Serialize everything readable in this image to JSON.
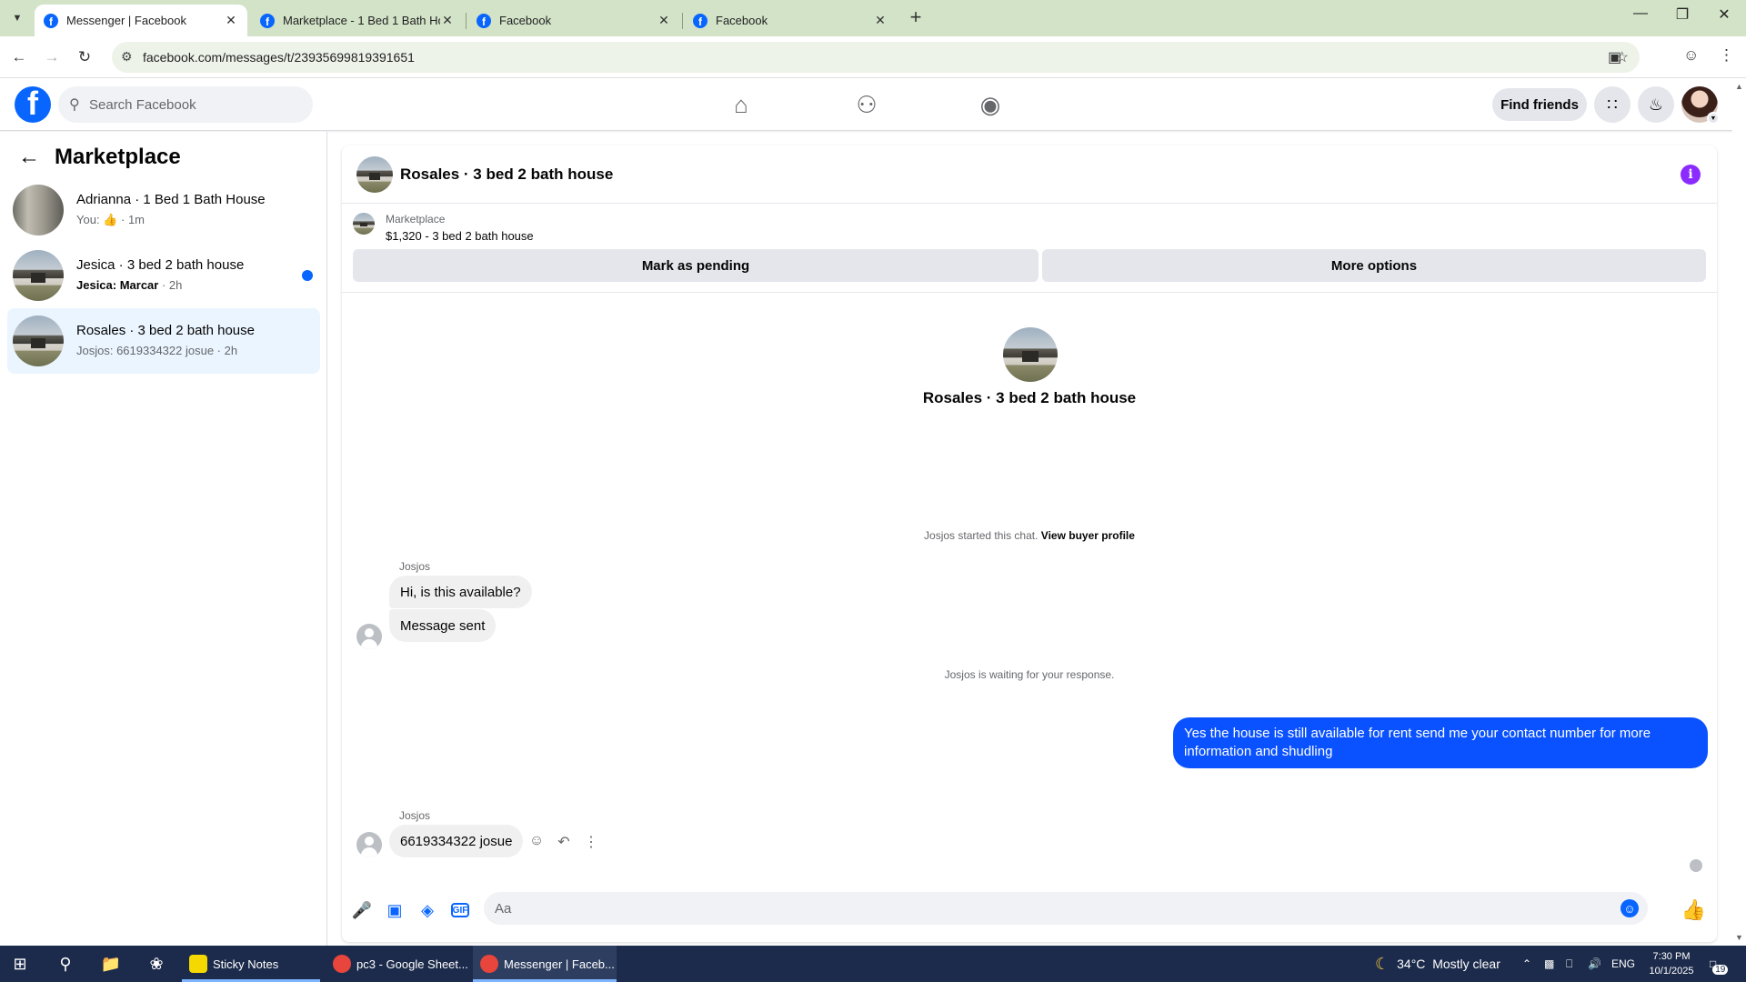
{
  "browser": {
    "tabs": [
      {
        "title": "Messenger | Facebook",
        "active": true
      },
      {
        "title": "Marketplace - 1 Bed 1 Bath Ho",
        "active": false
      },
      {
        "title": "Facebook",
        "active": false
      },
      {
        "title": "Facebook",
        "active": false
      }
    ],
    "url": "facebook.com/messages/t/23935699819391651"
  },
  "fb": {
    "search_placeholder": "Search Facebook",
    "find_friends": "Find friends"
  },
  "sidebar": {
    "title": "Marketplace",
    "conversations": [
      {
        "name": "Adrianna · 1 Bed 1 Bath House",
        "snippet_prefix": "You:",
        "snippet": "· 1m",
        "unread": false
      },
      {
        "name": "Jesica · 3 bed 2 bath house",
        "snippet_prefix": "Jesica: Marcar",
        "snippet": "· 2h",
        "unread": true
      },
      {
        "name": "Rosales · 3 bed 2 bath house",
        "snippet_prefix": "",
        "snippet": "Josjos: 6619334322 josue · 2h",
        "unread": false
      }
    ]
  },
  "chat": {
    "title": "Rosales · 3 bed 2 bath house",
    "listing_label": "Marketplace",
    "listing_price": "$1,320 - 3 bed 2 bath house",
    "mark_pending": "Mark as pending",
    "more_options": "More options",
    "intro_title": "Rosales · 3 bed 2 bath house",
    "started_text": "Josjos started this chat.",
    "view_profile": "View buyer profile",
    "sender_name": "Josjos",
    "msg1": "Hi, is this available?",
    "msg2": "Message sent",
    "waiting_text": "Josjos is waiting for your response.",
    "out_msg": "Yes the house is still available for rent send me your contact number for more information and shudling",
    "msg3": "6619334322 josue",
    "composer_placeholder": "Aa"
  },
  "taskbar": {
    "apps": [
      {
        "label": "Sticky Notes",
        "color": "#f5d800"
      },
      {
        "label": "pc3 - Google Sheet...",
        "color": "#e8453c"
      },
      {
        "label": "Messenger | Faceb...",
        "color": "#e8453c"
      }
    ],
    "weather": "34°C  Mostly clear",
    "lang": "ENG",
    "time": "7:30 PM",
    "date": "10/1/2025",
    "notif_count": "19"
  },
  "colors": {
    "fb_blue": "#0866ff",
    "outgoing_bubble": "#0a52ff",
    "selected_conv": "#ebf5ff",
    "info_purple": "#8b2bff"
  }
}
